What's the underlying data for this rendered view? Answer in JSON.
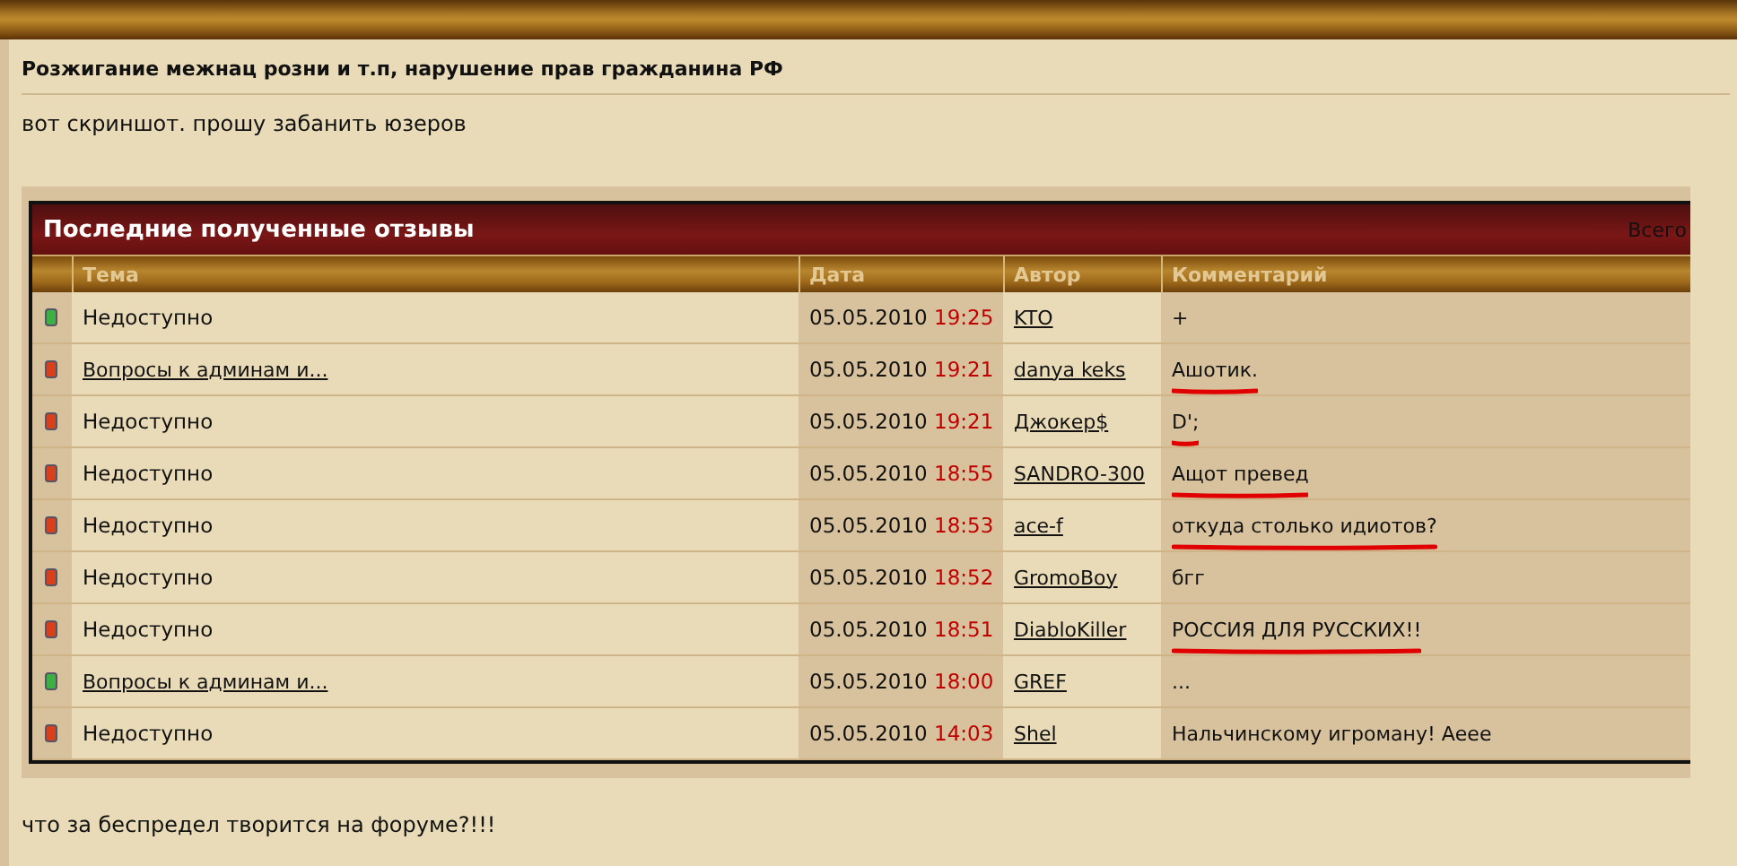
{
  "post": {
    "title": "Розжигание межнац розни и т.п, нарушение прав гражданина РФ",
    "text": "вот скриншот. прошу забанить юзеров",
    "footer_text": "что за беспредел творится на форуме?!!!"
  },
  "table": {
    "title": "Последние полученные отзывы",
    "corner_text": "Всего",
    "columns": [
      "Тема",
      "Дата",
      "Автор",
      "Комментарий"
    ],
    "rows": [
      {
        "color": "#3cb043",
        "topic": "Недоступно",
        "kind": "text",
        "date": "05.05.2010",
        "time": "19:25",
        "author": "KTO",
        "comment": "+",
        "underlined": false
      },
      {
        "color": "#d8401c",
        "topic": "Вопросы к админам и...",
        "kind": "link",
        "date": "05.05.2010",
        "time": "19:21",
        "author": "danya keks",
        "comment": "Ашотик.",
        "underlined": true
      },
      {
        "color": "#d8401c",
        "topic": "Недоступно",
        "kind": "text",
        "date": "05.05.2010",
        "time": "19:21",
        "author": "Джокер$",
        "comment": "D';",
        "underlined": true
      },
      {
        "color": "#d8401c",
        "topic": "Недоступно",
        "kind": "text",
        "date": "05.05.2010",
        "time": "18:55",
        "author": "SANDRO-300",
        "comment": "Ащот превед",
        "underlined": true
      },
      {
        "color": "#d8401c",
        "topic": "Недоступно",
        "kind": "text",
        "date": "05.05.2010",
        "time": "18:53",
        "author": "ace-f",
        "comment": "откуда столько идиотов?",
        "underlined": true
      },
      {
        "color": "#d8401c",
        "topic": "Недоступно",
        "kind": "text",
        "date": "05.05.2010",
        "time": "18:52",
        "author": "GromoBoy",
        "comment": "бгг",
        "underlined": false
      },
      {
        "color": "#d8401c",
        "topic": "Недоступно",
        "kind": "text",
        "date": "05.05.2010",
        "time": "18:51",
        "author": "DiabloKiller",
        "comment": "РОССИЯ ДЛЯ РУССКИХ!!",
        "underlined": true
      },
      {
        "color": "#3cb043",
        "topic": "Вопросы к админам и...",
        "kind": "link",
        "date": "05.05.2010",
        "time": "18:00",
        "author": "GREF",
        "comment": "...",
        "underlined": false
      },
      {
        "color": "#d8401c",
        "topic": "Недоступно",
        "kind": "text",
        "date": "05.05.2010",
        "time": "14:03",
        "author": "Shel",
        "comment": "Нальчинскому игроману! Аеее",
        "underlined": false
      }
    ]
  }
}
